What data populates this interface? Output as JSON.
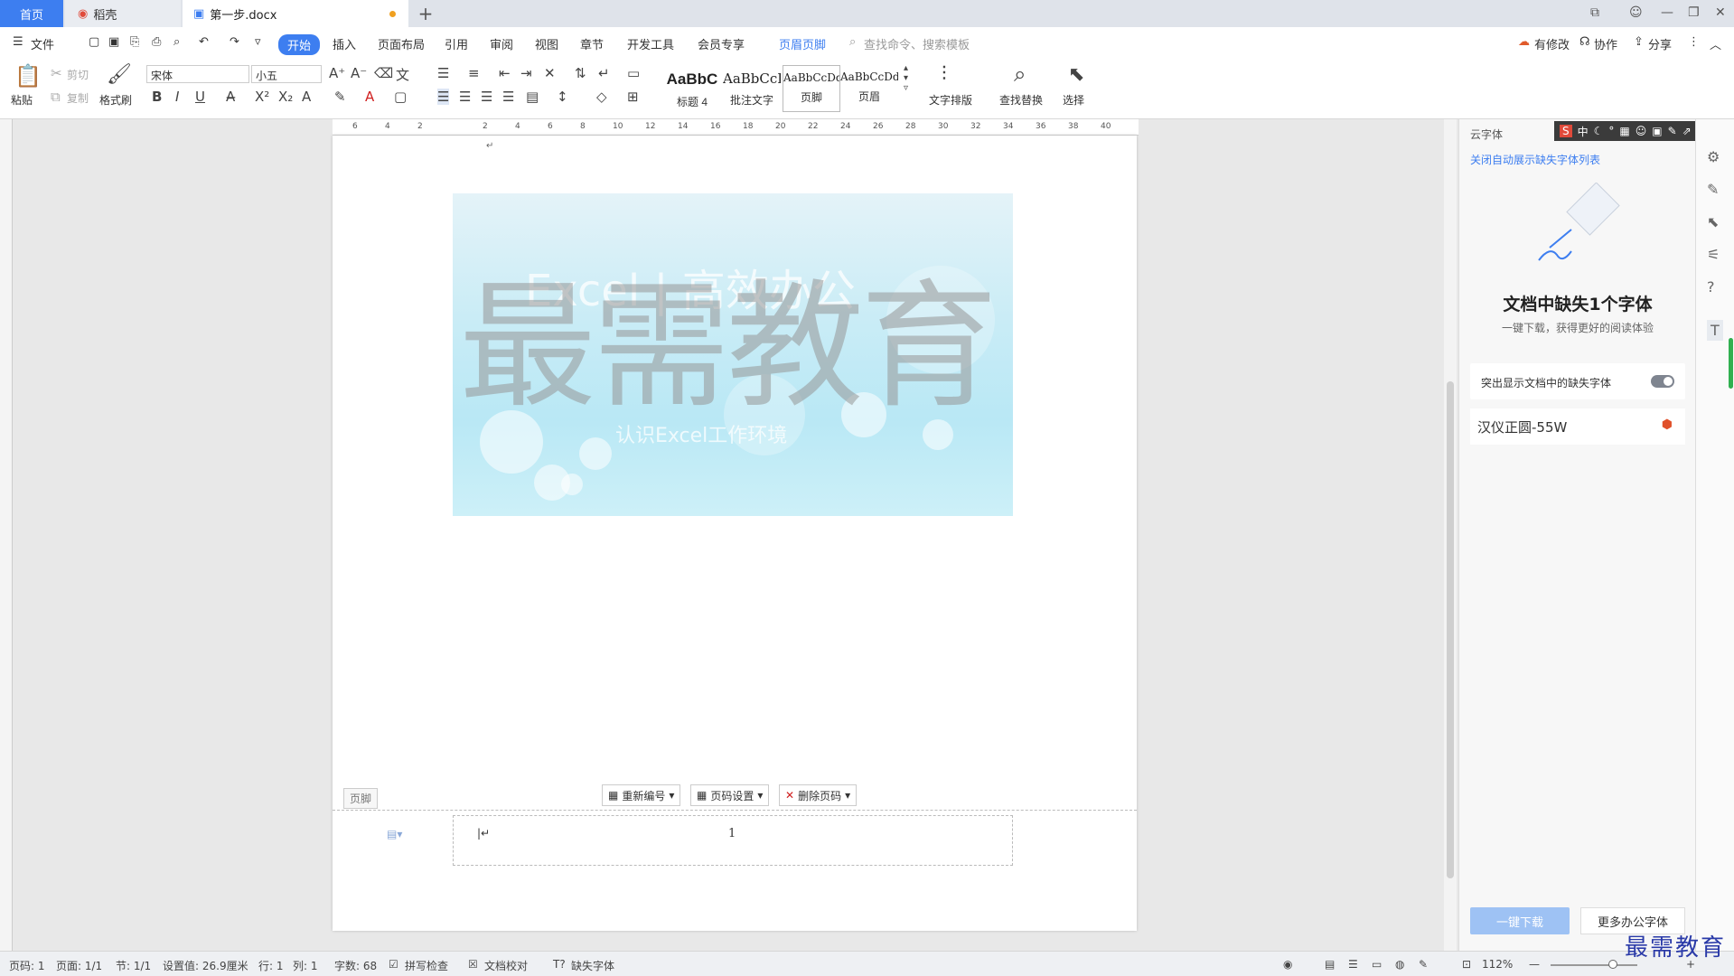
{
  "tabs": {
    "home": "首页",
    "daoke": "稻壳",
    "doc": "第一步.docx",
    "add": "+"
  },
  "menu": {
    "file": "文件",
    "start": "开始",
    "insert": "插入",
    "layout": "页面布局",
    "reference": "引用",
    "review": "审阅",
    "view": "视图",
    "chapter": "章节",
    "devtools": "开发工具",
    "member": "会员专享",
    "header_footer": "页眉页脚",
    "search": "查找命令、搜索模板",
    "has_changes": "有修改",
    "collab": "协作",
    "share": "分享"
  },
  "ribbon": {
    "paste": "粘贴",
    "cut": "剪切",
    "copy": "复制",
    "format_painter": "格式刷",
    "font": "宋体",
    "size": "小五",
    "text_layout": "文字排版",
    "find_replace": "查找替换",
    "select": "选择",
    "styles": [
      {
        "sample": "AaBbC",
        "label": "标题 4"
      },
      {
        "sample": "AaBbCcI",
        "label": "批注文字"
      },
      {
        "sample": "AaBbCcDd",
        "label": "页脚"
      },
      {
        "sample": "AaBbCcDd",
        "label": "页眉"
      }
    ]
  },
  "ruler": {
    "h": [
      "6",
      "4",
      "2",
      "",
      "2",
      "4",
      "6",
      "8",
      "10",
      "12",
      "14",
      "16",
      "18",
      "20",
      "22",
      "24",
      "26",
      "28",
      "30",
      "32",
      "34",
      "36",
      "38",
      "40"
    ]
  },
  "document": {
    "banner_line1": "Excel | 高效办公",
    "banner_line2": "认识Excel工作环境",
    "watermark": "最需教育",
    "footer_label": "页脚",
    "renumber": "重新编号",
    "page_setup": "页码设置",
    "delete_page": "删除页码",
    "page_number": "1"
  },
  "panel": {
    "title": "云字体",
    "close_link": "关闭自动展示缺失字体列表",
    "heading": "文档中缺失1个字体",
    "subheading": "一键下载，获得更好的阅读体验",
    "highlight_label": "突出显示文档中的缺失字体",
    "missing_font": "汉仪正圆-55W",
    "download": "一键下载",
    "more_fonts": "更多办公字体"
  },
  "status": {
    "page": "页码: 1",
    "pages": "页面: 1/1",
    "section": "节: 1/1",
    "setting": "设置值: 26.9厘米",
    "row": "行: 1",
    "col": "列: 1",
    "words": "字数: 68",
    "spell": "拼写检查",
    "proof": "文档校对",
    "missing": "缺失字体",
    "zoom": "112%"
  },
  "brand": "最需教育"
}
